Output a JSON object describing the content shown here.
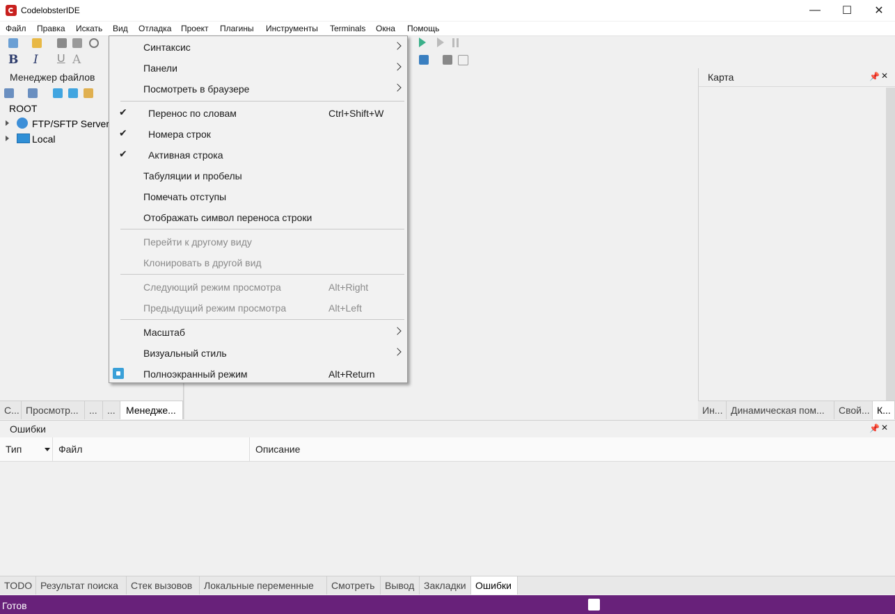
{
  "window": {
    "title": "CodelobsterIDE",
    "controls": [
      "—",
      "☐",
      "✕"
    ]
  },
  "menubar": [
    "Файл",
    "Правка",
    "Искать",
    "Вид",
    "Отладка",
    "Проект",
    "Плагины",
    "Инструменты",
    "Terminals",
    "Окна",
    "Помощь"
  ],
  "left_panel": {
    "title": "Менеджер файлов",
    "root": "ROOT",
    "nodes": [
      "FTP/SFTP Servers",
      "Local"
    ],
    "tabs": [
      "С...",
      "Просмотр...",
      "...",
      "...",
      "Менедже..."
    ]
  },
  "right_panel": {
    "title": "Карта",
    "tabs": [
      "Ин...",
      "Динамическая пом...",
      "Свой...",
      "К..."
    ]
  },
  "view_menu": {
    "items": [
      {
        "label": "Синтаксис",
        "submenu": true
      },
      {
        "label": "Панели",
        "submenu": true
      },
      {
        "label": "Посмотреть в браузере",
        "submenu": true
      },
      {
        "label": "Перенос по словам",
        "shortcut": "Ctrl+Shift+W",
        "checked": true
      },
      {
        "label": "Номера строк",
        "checked": true
      },
      {
        "label": "Активная строка",
        "checked": true
      },
      {
        "label": "Табуляции и пробелы"
      },
      {
        "label": "Помечать отступы"
      },
      {
        "label": "Отображать символ переноса строки"
      },
      {
        "label": "Перейти к другому виду",
        "disabled": true
      },
      {
        "label": "Клонировать в другой вид",
        "disabled": true
      },
      {
        "label": "Следующий режим просмотра",
        "shortcut": "Alt+Right",
        "disabled": true
      },
      {
        "label": "Предыдущий режим просмотра",
        "shortcut": "Alt+Left",
        "disabled": true
      },
      {
        "label": "Масштаб",
        "submenu": true
      },
      {
        "label": "Визуальный стиль",
        "submenu": true
      },
      {
        "label": "Полноэкранный режим",
        "shortcut": "Alt+Return",
        "icon": "fullscreen-icon"
      }
    ]
  },
  "errors_panel": {
    "title": "Ошибки",
    "columns": [
      "Тип",
      "Файл",
      "Описание"
    ]
  },
  "bottom_tabs": [
    "TODO",
    "Результат поиска",
    "Стек вызовов",
    "Локальные переменные",
    "Смотреть",
    "Вывод",
    "Закладки",
    "Ошибки"
  ],
  "status": {
    "text": "Готов"
  },
  "colors": {
    "status_bar": "#68217a",
    "fullscreen_icon": "#3aa0d8",
    "app_icon": "#c8201e"
  }
}
